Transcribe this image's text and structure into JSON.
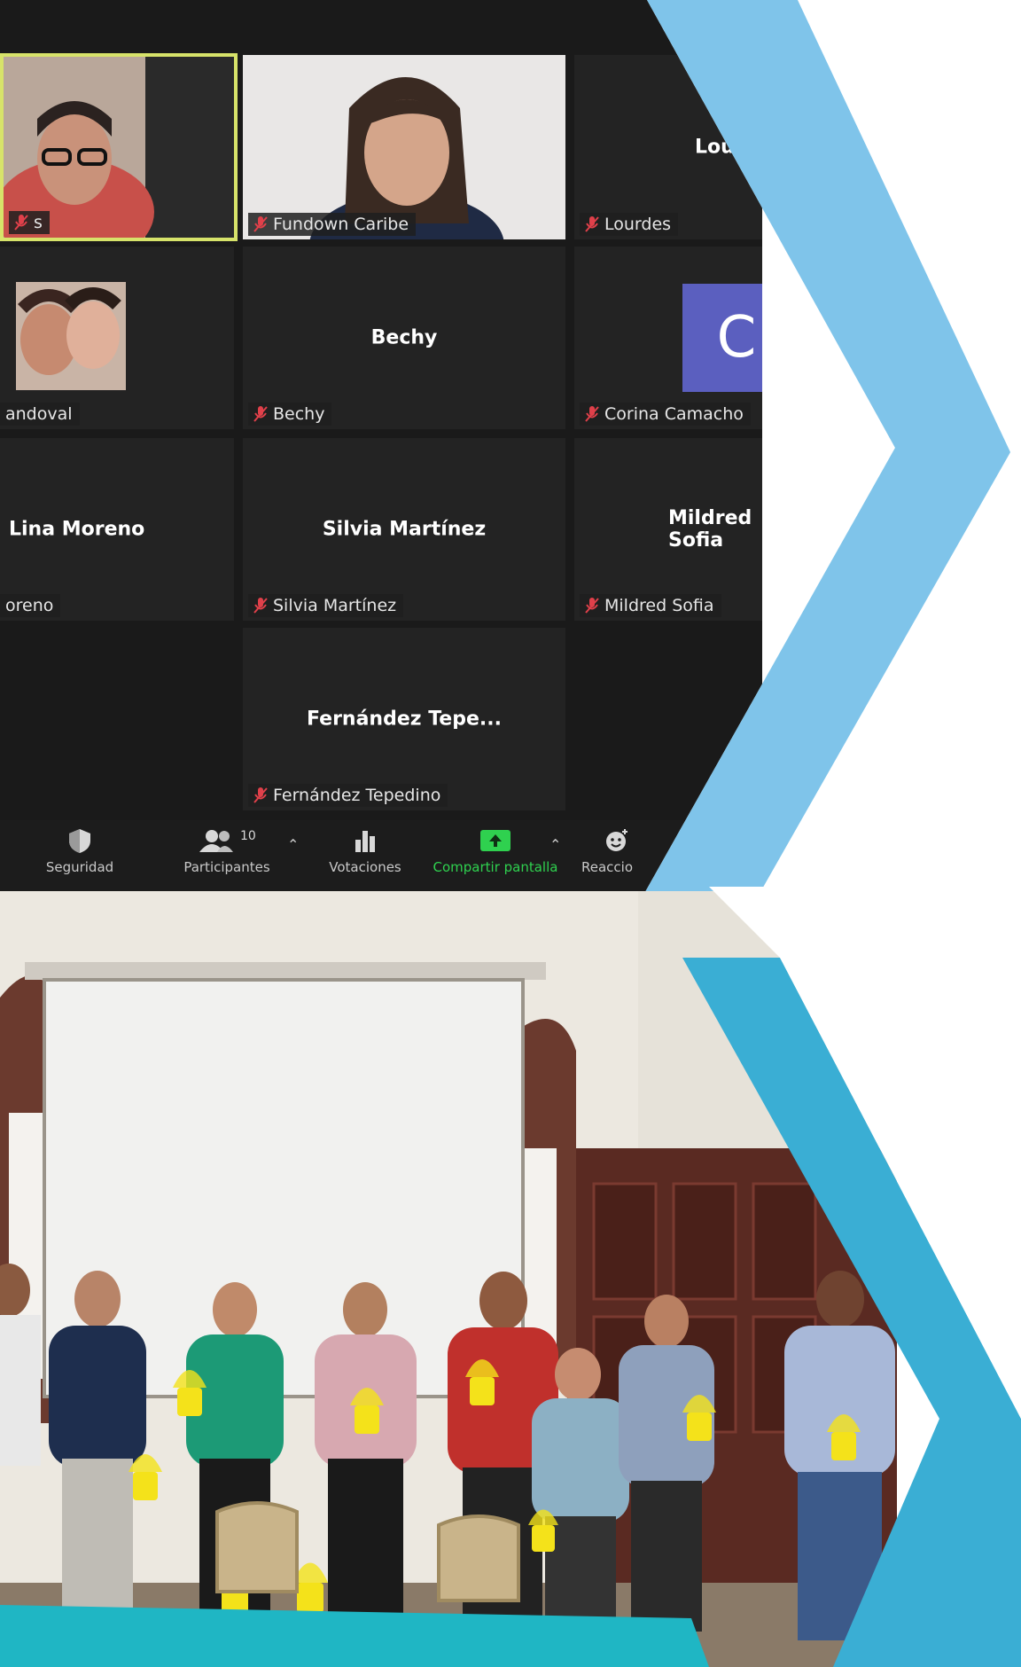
{
  "meeting": {
    "tiles": [
      {
        "id": "p1",
        "display_name": "",
        "label": "s",
        "video": true
      },
      {
        "id": "p2",
        "display_name": "",
        "label": "Fundown Caribe",
        "video": true
      },
      {
        "id": "p3",
        "display_name": "Lou",
        "label": "Lourdes",
        "video": false
      },
      {
        "id": "p4",
        "display_name": "",
        "label": "andoval",
        "video": true
      },
      {
        "id": "p5",
        "display_name": "Bechy",
        "label": "Bechy",
        "video": false
      },
      {
        "id": "p6",
        "display_name": "",
        "label": "Corina Camacho",
        "avatar_letter": "C",
        "video": false
      },
      {
        "id": "p7",
        "display_name": "Lina Moreno",
        "label": "oreno",
        "video": false
      },
      {
        "id": "p8",
        "display_name": "Silvia Martínez",
        "label": "Silvia Martínez",
        "video": false
      },
      {
        "id": "p9",
        "display_name": "Mildred Sofia",
        "label": "Mildred Sofia",
        "video": false
      },
      {
        "id": "p10",
        "display_name": "Fernández Tepe...",
        "label": "Fernández Tepedino",
        "video": false
      }
    ],
    "toolbar": {
      "security": "Seguridad",
      "participants": "Participantes",
      "participants_count": "10",
      "polls": "Votaciones",
      "share": "Compartir pantalla",
      "reactions": "Reaccio"
    }
  },
  "colors": {
    "chevron_light": "#7fc4ea",
    "chevron_dark": "#3aaed4",
    "zoom_bg": "#1a1a1a",
    "active_border": "#d7e36a",
    "share_green": "#2fd14f",
    "avatar": "#5b5fbf"
  }
}
